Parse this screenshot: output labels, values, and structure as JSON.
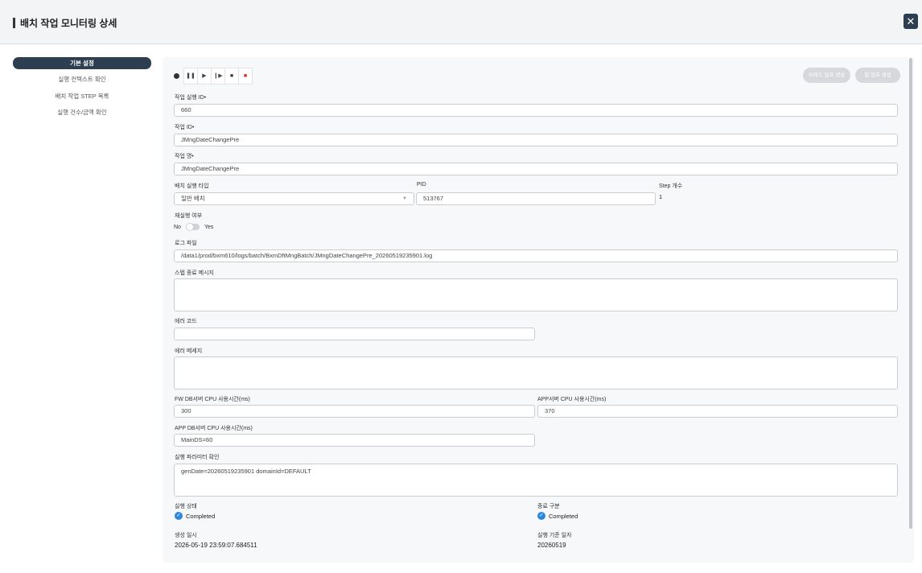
{
  "window": {
    "title": "배치 작업 모니터링 상세",
    "close_label": "✕"
  },
  "sidebar": {
    "items": [
      {
        "label": "기본 설정",
        "active": true
      },
      {
        "label": "실행 컨텍스트 확인",
        "active": false
      },
      {
        "label": "배치 작업 STEP 목록",
        "active": false
      },
      {
        "label": "실행 건수/금액 확인",
        "active": false
      }
    ]
  },
  "toolbar": {
    "icons": [
      "record-icon",
      "pause-icon",
      "play-icon",
      "step-forward-icon",
      "stop-icon",
      "stop-red-icon"
    ],
    "glyphs": {
      "pause": "❚❚",
      "play": "▶",
      "step": "❙▶",
      "stop": "■",
      "stop_red": "■"
    },
    "thread_dump_label": "쓰레드 덤프 생성",
    "heap_dump_label": "힙 덤프 생성"
  },
  "form": {
    "job_exec_id": {
      "label": "작업 실행 ID•",
      "value": "660"
    },
    "job_id": {
      "label": "작업 ID•",
      "value": "JMngDateChangePre"
    },
    "job_name": {
      "label": "작업 명•",
      "value": "JMngDateChangePre"
    },
    "exec_type": {
      "label": "배치 실행 타입",
      "value": "일반 배치"
    },
    "pid": {
      "label": "PID",
      "value": "513767"
    },
    "step_count": {
      "label": "Step 개수",
      "value": "1"
    },
    "rerun": {
      "label": "재실행 여부",
      "off_label": "No",
      "on_label": "Yes",
      "enabled": false
    },
    "log_file": {
      "label": "로그 파일",
      "value": "/data1/prod/bxm610/logs/batch/BxmDftMngBatch/JMngDateChangePre_20260519235901.log"
    },
    "step_end_msg": {
      "label": "스텝 종료 메시지",
      "value": ""
    },
    "error_code": {
      "label": "에러 코드",
      "value": ""
    },
    "error_msg": {
      "label": "에러 메세지",
      "value": ""
    },
    "fw_db_cpu": {
      "label": "FW DB서버 CPU 사용시간(ms)",
      "value": "300"
    },
    "app_cpu": {
      "label": "APP서버 CPU 사용시간(ms)",
      "value": "370"
    },
    "app_db_cpu": {
      "label": "APP DB서버 CPU 사용시간(ms)",
      "value": "MainDS=60"
    },
    "exec_params": {
      "label": "실행 파라미터 확인",
      "value": "genDate=20260519235901 domainId=DEFAULT"
    },
    "exec_status": {
      "label": "실행 상태",
      "value": "Completed"
    },
    "end_type": {
      "label": "종료 구분",
      "value": "Completed"
    },
    "created_at": {
      "label": "생성 일시",
      "value": "2026-05-19 23:59:07.684511"
    },
    "base_date": {
      "label": "실행 기준 일자",
      "value": "20260519"
    }
  },
  "colors": {
    "accent": "#2c3e50",
    "status_ok": "#2e86de",
    "stop_red": "#e02424"
  }
}
